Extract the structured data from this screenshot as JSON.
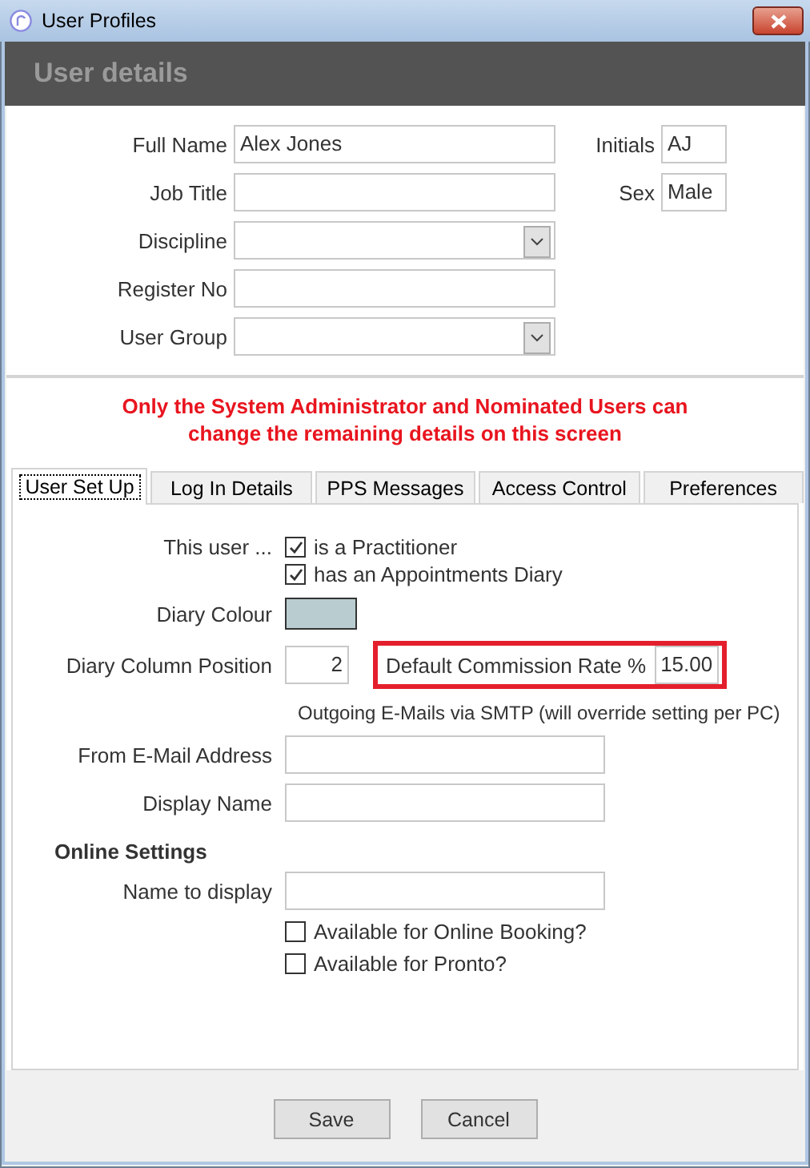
{
  "window": {
    "title": "User Profiles"
  },
  "header": {
    "title": "User details"
  },
  "details_fields": [
    {
      "label": "Full Name",
      "value": "Alex Jones",
      "kind": "text"
    },
    {
      "label": "Job Title",
      "kind": "text"
    },
    {
      "label": "Discipline",
      "kind": "dropdown"
    },
    {
      "label": "Register No",
      "kind": "text"
    },
    {
      "label": "User Group",
      "kind": "dropdown"
    }
  ],
  "side_fields": [
    {
      "label": "Initials",
      "value": "AJ"
    },
    {
      "label": "Sex",
      "value": "Male"
    }
  ],
  "notice_lines": [
    "Only the System Administrator and Nominated Users can",
    "change the remaining details on this screen"
  ],
  "tabs": [
    {
      "label": "User Set Up",
      "selected": true
    },
    {
      "label": "Log In Details",
      "selected": false
    },
    {
      "label": "PPS Messages",
      "selected": false
    },
    {
      "label": "Access Control",
      "selected": false
    },
    {
      "label": "Preferences",
      "selected": false
    }
  ],
  "user_setup": {
    "this_user_label": "This user ...",
    "roles": [
      {
        "label": "is a Practitioner",
        "checked": true
      },
      {
        "label": "has an Appointments Diary",
        "checked": true
      }
    ],
    "diary_colour": {
      "label": "Diary Colour",
      "color": "#b9cdd0"
    },
    "diary_column_position": {
      "label": "Diary Column Position",
      "value": "2"
    },
    "commission_rate": {
      "label": "Default Commission Rate %",
      "value": "15.00",
      "highlighted": true
    },
    "smtp_note": "Outgoing E-Mails via SMTP (will override setting per PC)",
    "email_fields": [
      {
        "label": "From E-Mail Address"
      },
      {
        "label": "Display Name"
      }
    ],
    "online_settings": {
      "heading": "Online Settings",
      "name_field": {
        "label": "Name to display"
      },
      "options": [
        {
          "label": "Available for Online Booking?",
          "checked": false
        },
        {
          "label": "Available for Pronto?",
          "checked": false
        }
      ]
    }
  },
  "buttons": [
    {
      "label": "Save"
    },
    {
      "label": "Cancel"
    }
  ]
}
